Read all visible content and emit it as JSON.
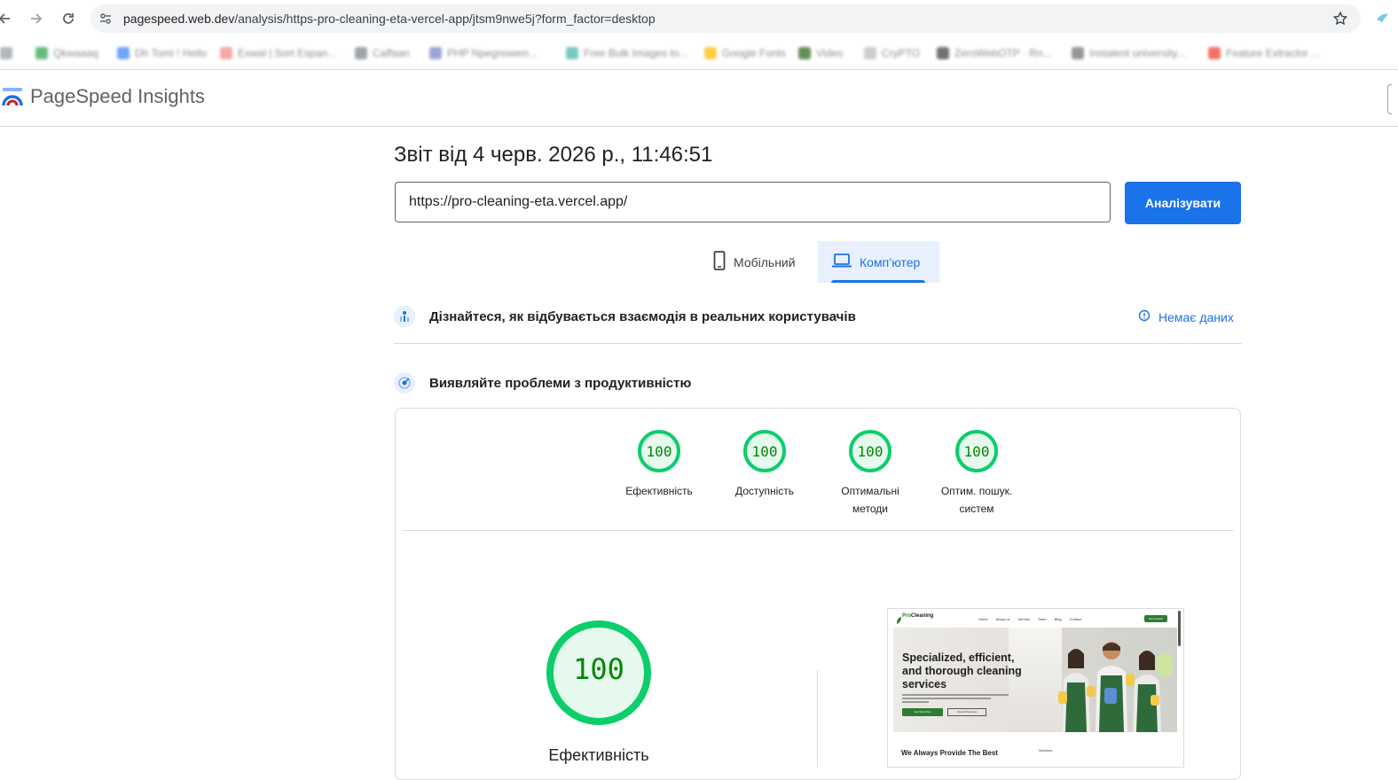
{
  "browser": {
    "url_host": "pagespeed.web.dev",
    "url_path": "/analysis/https-pro-cleaning-eta-vercel-app/jtsm9nwe5j?form_factor=desktop",
    "bookmarks_end": "co"
  },
  "app": {
    "title": "PageSpeed Insights"
  },
  "report": {
    "title": "Звіт від 4 черв. 2026 р., 11:46:51",
    "url_value": "https://pro-cleaning-eta.vercel.app/",
    "analyze_label": "Аналізувати"
  },
  "tabs": [
    {
      "label": "Мобільний",
      "icon": "smartphone-icon",
      "selected": false
    },
    {
      "label": "Комп’ютер",
      "icon": "laptop-icon",
      "selected": true
    }
  ],
  "crux": {
    "text": "Дізнайтеся, як відбувається взаємодія в реальних користувачів",
    "no_data": "Немає даних"
  },
  "lab": {
    "text": "Виявляйте проблеми з продуктивністю"
  },
  "scores": [
    {
      "value": "100",
      "label": "Ефективність"
    },
    {
      "value": "100",
      "label": "Доступність"
    },
    {
      "value": "100",
      "label": "Оптимальні методи"
    },
    {
      "value": "100",
      "label": "Оптим. пошук. систем"
    }
  ],
  "big_score": {
    "value": "100",
    "label": "Ефективність"
  },
  "thumbnail": {
    "logo_a": "Pro",
    "logo_b": "Cleaning",
    "nav": [
      "Home",
      "About us",
      "Service",
      "Team",
      "Blog",
      "Contact"
    ],
    "cta": "Get a quote",
    "heading": "Specialized, efficient, and thorough cleaning services",
    "btn_primary": "Get Start Now",
    "btn_secondary": "View all Services",
    "footer_heading": "We Always Provide The Best",
    "footer_side": "Services"
  },
  "colors": {
    "accent": "#1a73e8",
    "pass_green": "#0cce6b",
    "pass_text": "#008800",
    "pass_fill": "#e6f9ee"
  }
}
